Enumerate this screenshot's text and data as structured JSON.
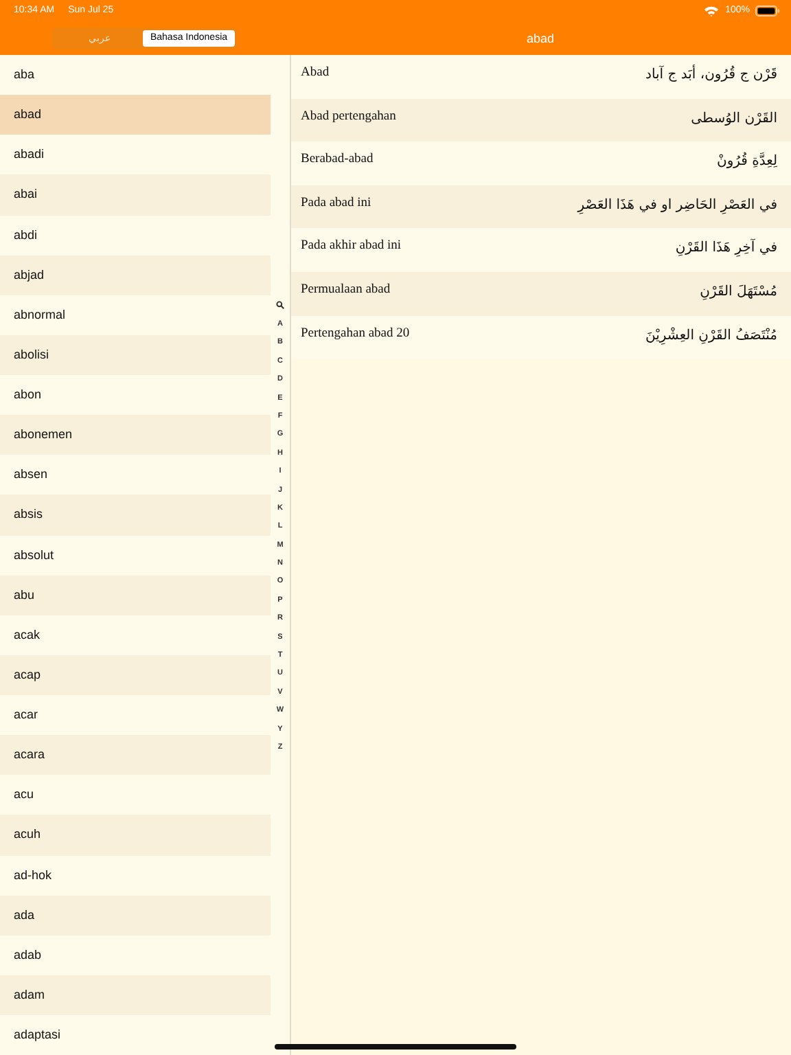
{
  "status_bar": {
    "time": "10:34 AM",
    "date": "Sun Jul 25",
    "battery": "100%"
  },
  "language_toggle": [
    {
      "label": "عربي",
      "selected": false
    },
    {
      "label": "Bahasa Indonesia",
      "selected": true
    }
  ],
  "detail_title": "abad",
  "words": [
    {
      "label": "aba",
      "selected": false
    },
    {
      "label": "abad",
      "selected": true
    },
    {
      "label": "abadi",
      "selected": false
    },
    {
      "label": "abai",
      "selected": false
    },
    {
      "label": "abdi",
      "selected": false
    },
    {
      "label": "abjad",
      "selected": false
    },
    {
      "label": "abnormal",
      "selected": false
    },
    {
      "label": "abolisi",
      "selected": false
    },
    {
      "label": "abon",
      "selected": false
    },
    {
      "label": "abonemen",
      "selected": false
    },
    {
      "label": "absen",
      "selected": false
    },
    {
      "label": "absis",
      "selected": false
    },
    {
      "label": "absolut",
      "selected": false
    },
    {
      "label": "abu",
      "selected": false
    },
    {
      "label": "acak",
      "selected": false
    },
    {
      "label": "acap",
      "selected": false
    },
    {
      "label": "acar",
      "selected": false
    },
    {
      "label": "acara",
      "selected": false
    },
    {
      "label": "acu",
      "selected": false
    },
    {
      "label": "acuh",
      "selected": false
    },
    {
      "label": "ad-hok",
      "selected": false
    },
    {
      "label": "ada",
      "selected": false
    },
    {
      "label": "adab",
      "selected": false
    },
    {
      "label": "adam",
      "selected": false
    },
    {
      "label": "adaptasi",
      "selected": false
    }
  ],
  "index_letters": [
    "A",
    "B",
    "C",
    "D",
    "E",
    "F",
    "G",
    "H",
    "I",
    "J",
    "K",
    "L",
    "M",
    "N",
    "O",
    "P",
    "R",
    "S",
    "T",
    "U",
    "V",
    "W",
    "Y",
    "Z"
  ],
  "translations": [
    {
      "indonesian": "Abad",
      "arabic": "قَرْن ج قُرُون، أبَد ج آباد"
    },
    {
      "indonesian": "Abad pertengahan",
      "arabic": "القَرْن الوُسطى"
    },
    {
      "indonesian": "Berabad-abad",
      "arabic": "لِعِدَّةِ قُرُونْ"
    },
    {
      "indonesian": "Pada abad ini",
      "arabic": "في العَصْرِ الحَاضِر او في هَذَا العَصْرِ"
    },
    {
      "indonesian": "Pada akhir abad ini",
      "arabic": "في آخِرِ هَذَا القَرْنِ"
    },
    {
      "indonesian": "Permualaan abad",
      "arabic": "مُسْتَهَلَ القَرْنِ"
    },
    {
      "indonesian": "Pertengahan abad 20",
      "arabic": "مُنْتَصَفُ القَرْنِ العِشْرِيْنَ"
    }
  ]
}
